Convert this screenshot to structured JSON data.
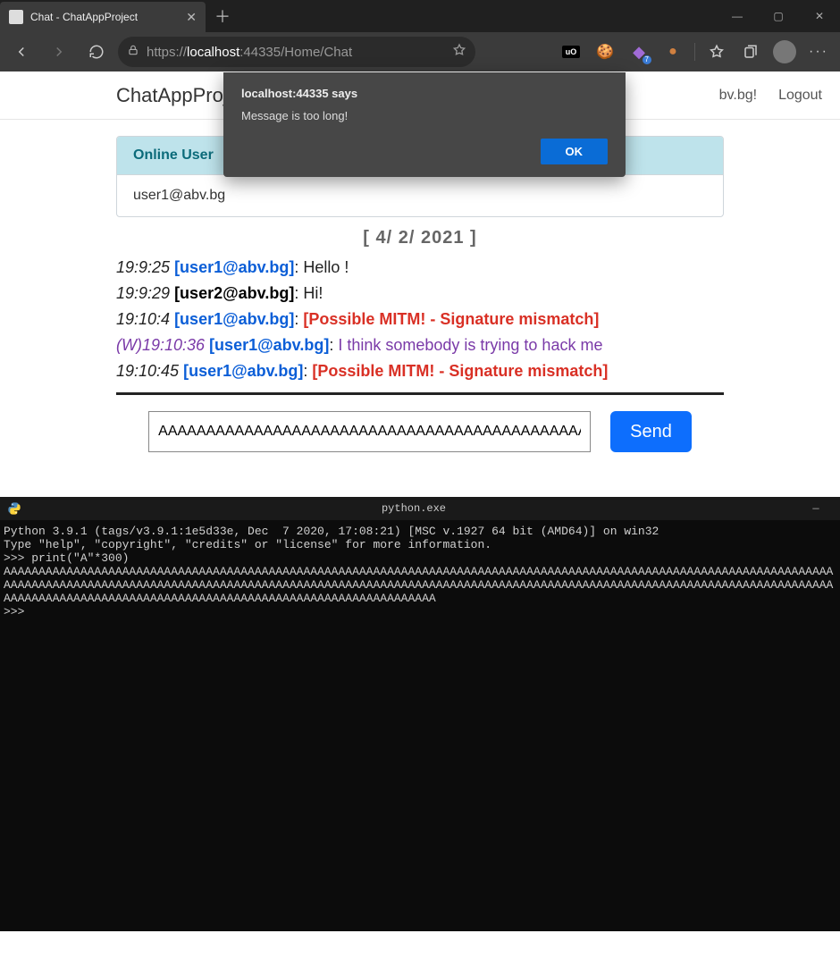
{
  "browser": {
    "tab_title": "Chat - ChatAppProject",
    "url_scheme": "https://",
    "url_host": "localhost",
    "url_port_path": ":44335/Home/Chat",
    "ext_badge": "7"
  },
  "alert": {
    "title": "localhost:44335 says",
    "body": "Message is too long!",
    "ok": "OK"
  },
  "nav": {
    "brand": "ChatAppProje",
    "hello_fragment": "bv.bg!",
    "logout": "Logout"
  },
  "online_users": {
    "header": "Online User",
    "users": [
      "user1@abv.bg"
    ]
  },
  "date_separator": "[ 4/ 2/ 2021 ]",
  "messages": [
    {
      "prefix": "",
      "ts": "19:9:25",
      "user": "[user1@abv.bg]",
      "user_style": "blue",
      "sep": ": ",
      "body": "Hello !",
      "body_style": "plain"
    },
    {
      "prefix": "",
      "ts": "19:9:29",
      "user": "[user2@abv.bg]",
      "user_style": "black",
      "sep": ": ",
      "body": "Hi!",
      "body_style": "plain"
    },
    {
      "prefix": "",
      "ts": "19:10:4",
      "user": "[user1@abv.bg]",
      "user_style": "blue",
      "sep": ": ",
      "body": "[Possible MITM! - Signature mismatch]",
      "body_style": "err"
    },
    {
      "prefix": "(W)",
      "ts": "19:10:36",
      "user": "[user1@abv.bg]",
      "user_style": "blue",
      "sep": ": ",
      "body": "I think somebody is trying to hack me",
      "body_style": "purple"
    },
    {
      "prefix": "",
      "ts": "19:10:45",
      "user": "[user1@abv.bg]",
      "user_style": "blue",
      "sep": ": ",
      "body": "[Possible MITM! - Signature mismatch]",
      "body_style": "err"
    }
  ],
  "compose": {
    "input_value": "AAAAAAAAAAAAAAAAAAAAAAAAAAAAAAAAAAAAAAAAAAAAAAAAAAAAAAAAAA",
    "send": "Send"
  },
  "terminal": {
    "title": "python.exe",
    "lines": [
      "",
      "Python 3.9.1 (tags/v3.9.1:1e5d33e, Dec  7 2020, 17:08:21) [MSC v.1927 64 bit (AMD64)] on win32",
      "Type \"help\", \"copyright\", \"credits\" or \"license\" for more information.",
      ">>> print(\"A\"*300)",
      "AAAAAAAAAAAAAAAAAAAAAAAAAAAAAAAAAAAAAAAAAAAAAAAAAAAAAAAAAAAAAAAAAAAAAAAAAAAAAAAAAAAAAAAAAAAAAAAAAAAAAAAAAAAAAAAAAAAAAAAAAAAAAAAAAAAAAAAAAAAAAAAAAAAAAAAAAAAAAAAAAAAAAAAAAAAAAAAAAAAAAAAAAAAAAAAAAAAAAAAAAAAAAAAAAAAAAAAAAAAAAAAAAAAAAAAAAAAAAAAAAAAAAAAAAAAAAAAAAAAAAAAAAAAAAAAAAAAAAAAAAAAAAAAAAAAAAAAAAAAA",
      ">>> "
    ]
  }
}
